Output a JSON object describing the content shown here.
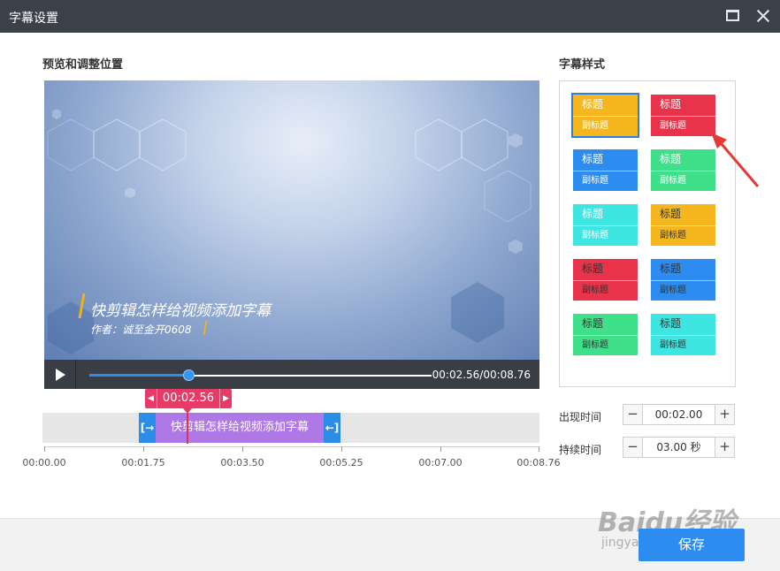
{
  "window": {
    "title": "字幕设置"
  },
  "preview": {
    "section_label": "预览和调整位置",
    "caption_title": "快剪辑怎样给视频添加字幕",
    "caption_subtitle": "作者：诚至金开0608"
  },
  "player": {
    "time": "00:02.56/00:08.76",
    "progress": 0.29
  },
  "timeline": {
    "cursor_time": "00:02.56",
    "clip_text": "快剪辑怎样给视频添加字幕",
    "handle_left": "[→",
    "handle_right": "←]",
    "ticks": [
      "00:00.00",
      "00:01.75",
      "00:03.50",
      "00:05.25",
      "00:07.00",
      "00:08.76"
    ]
  },
  "styles": {
    "section_label": "字幕样式",
    "templates": [
      {
        "title": "标题",
        "subtitle": "副标题",
        "top": "#f5b71d",
        "bottom": "#f5b71d",
        "color": "#ffffff",
        "selected": true
      },
      {
        "title": "标题",
        "subtitle": "副标题",
        "top": "#e8334a",
        "bottom": "#e8334a",
        "color": "#ffffff",
        "selected": false
      },
      {
        "title": "标题",
        "subtitle": "副标题",
        "top": "#2d8cf0",
        "bottom": "#2d8cf0",
        "color": "#ffffff",
        "selected": false
      },
      {
        "title": "标题",
        "subtitle": "副标题",
        "top": "#3fe08a",
        "bottom": "#3fe08a",
        "color": "#ffffff",
        "selected": false
      },
      {
        "title": "标题",
        "subtitle": "副标题",
        "top": "#3de6e0",
        "bottom": "#3de6e0",
        "color": "#ffffff",
        "selected": false
      },
      {
        "title": "标题",
        "subtitle": "副标题",
        "top": "#f5b71d",
        "bottom": "#f5b71d",
        "color": "#333333",
        "selected": false
      },
      {
        "title": "标题",
        "subtitle": "副标题",
        "top": "#e8334a",
        "bottom": "#e8334a",
        "color": "#333333",
        "selected": false
      },
      {
        "title": "标题",
        "subtitle": "副标题",
        "top": "#2d8cf0",
        "bottom": "#2d8cf0",
        "color": "#333333",
        "selected": false
      },
      {
        "title": "标题",
        "subtitle": "副标题",
        "top": "#3fe08a",
        "bottom": "#3fe08a",
        "color": "#333333",
        "selected": false
      },
      {
        "title": "标题",
        "subtitle": "副标题",
        "top": "#3de6e0",
        "bottom": "#3de6e0",
        "color": "#333333",
        "selected": false
      }
    ]
  },
  "fields": {
    "appear_label": "出现时间",
    "appear_value": "00:02.00",
    "duration_label": "持续时间",
    "duration_value": "03.00 秒",
    "minus": "−",
    "plus": "+"
  },
  "footer": {
    "save_label": "保存"
  },
  "watermark": {
    "main": "Baidu经验",
    "sub": "jingyan.baidu.com"
  },
  "colors": {
    "accent": "#2d8cf0",
    "clip": "#ae78e6",
    "cursor": "#e73a67",
    "titlebar": "#3c4049"
  }
}
